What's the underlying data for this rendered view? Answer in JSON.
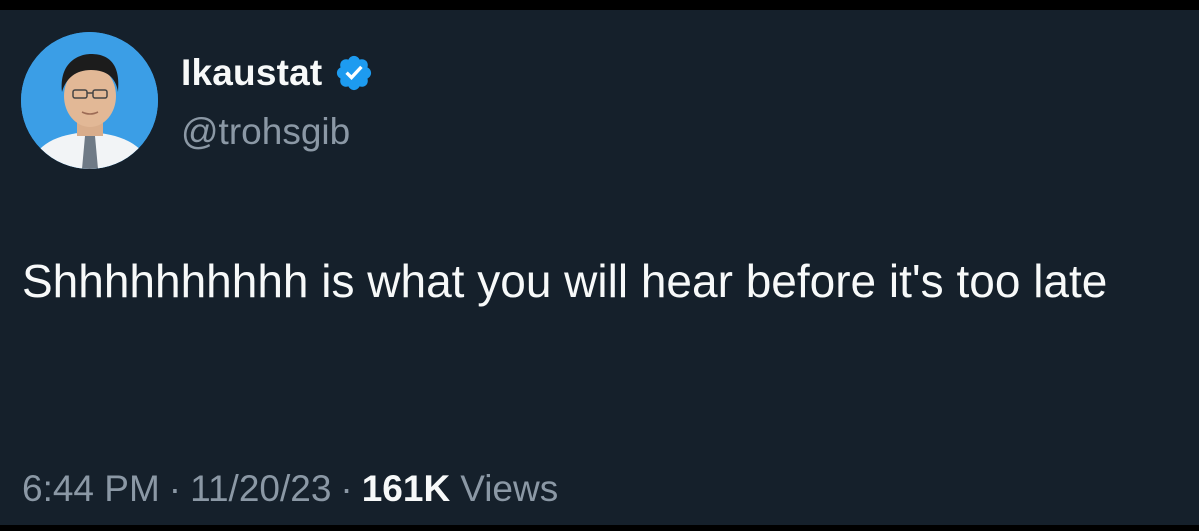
{
  "author": {
    "display_name": "Ikaustat",
    "handle": "@trohsgib",
    "verified": true,
    "verified_badge_color": "#1d9bf0"
  },
  "tweet": {
    "text": "Shhhhhhhhhh is what you will hear before it's too late"
  },
  "meta": {
    "time": "6:44 PM",
    "separator": "·",
    "date": "11/20/23",
    "views_count": "161K",
    "views_label": "Views"
  },
  "colors": {
    "background": "#15202b",
    "primary_text": "#f7f9f9",
    "secondary_text": "#8b98a5"
  }
}
